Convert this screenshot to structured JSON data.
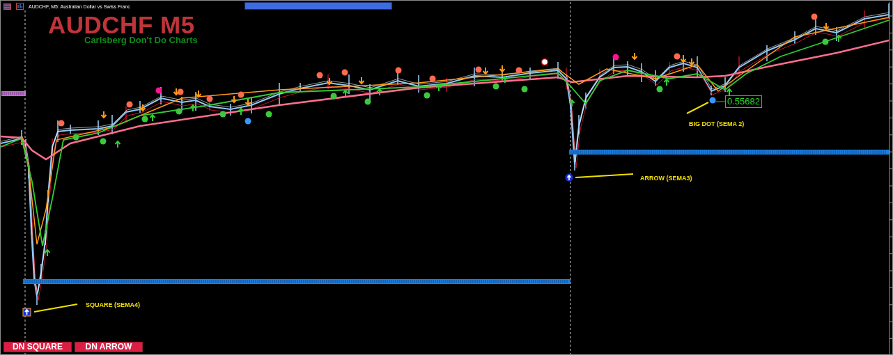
{
  "window": {
    "title": "AUDCHF, M5:  Australian Dollar vs Swiss Franc"
  },
  "chart_heading": {
    "title": "AUDCHF M5",
    "subtitle": "Carlsberg Don't Do Charts"
  },
  "annotations": [
    {
      "text": "SQUARE (SEMA4)"
    },
    {
      "text": "ARROW (SEMA3)"
    },
    {
      "text": "BIG DOT (SEMA 2)"
    }
  ],
  "price_label": "0.55682",
  "buttons": [
    {
      "label": "DN SQUARE"
    },
    {
      "label": "DN ARROW"
    }
  ]
}
